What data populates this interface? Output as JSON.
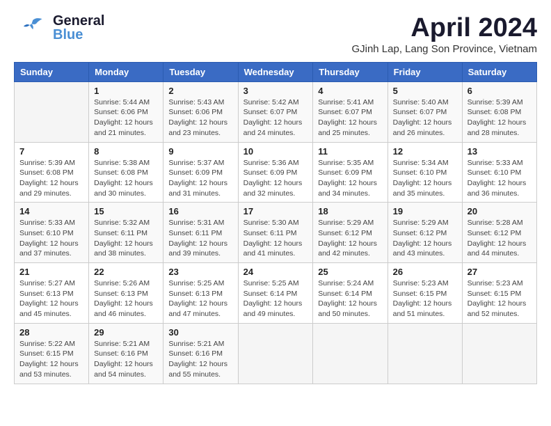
{
  "header": {
    "logo_general": "General",
    "logo_blue": "Blue",
    "month_title": "April 2024",
    "location": "GJinh Lap, Lang Son Province, Vietnam"
  },
  "weekdays": [
    "Sunday",
    "Monday",
    "Tuesday",
    "Wednesday",
    "Thursday",
    "Friday",
    "Saturday"
  ],
  "weeks": [
    [
      {
        "day": "",
        "info": ""
      },
      {
        "day": "1",
        "info": "Sunrise: 5:44 AM\nSunset: 6:06 PM\nDaylight: 12 hours\nand 21 minutes."
      },
      {
        "day": "2",
        "info": "Sunrise: 5:43 AM\nSunset: 6:06 PM\nDaylight: 12 hours\nand 23 minutes."
      },
      {
        "day": "3",
        "info": "Sunrise: 5:42 AM\nSunset: 6:07 PM\nDaylight: 12 hours\nand 24 minutes."
      },
      {
        "day": "4",
        "info": "Sunrise: 5:41 AM\nSunset: 6:07 PM\nDaylight: 12 hours\nand 25 minutes."
      },
      {
        "day": "5",
        "info": "Sunrise: 5:40 AM\nSunset: 6:07 PM\nDaylight: 12 hours\nand 26 minutes."
      },
      {
        "day": "6",
        "info": "Sunrise: 5:39 AM\nSunset: 6:08 PM\nDaylight: 12 hours\nand 28 minutes."
      }
    ],
    [
      {
        "day": "7",
        "info": "Sunrise: 5:39 AM\nSunset: 6:08 PM\nDaylight: 12 hours\nand 29 minutes."
      },
      {
        "day": "8",
        "info": "Sunrise: 5:38 AM\nSunset: 6:08 PM\nDaylight: 12 hours\nand 30 minutes."
      },
      {
        "day": "9",
        "info": "Sunrise: 5:37 AM\nSunset: 6:09 PM\nDaylight: 12 hours\nand 31 minutes."
      },
      {
        "day": "10",
        "info": "Sunrise: 5:36 AM\nSunset: 6:09 PM\nDaylight: 12 hours\nand 32 minutes."
      },
      {
        "day": "11",
        "info": "Sunrise: 5:35 AM\nSunset: 6:09 PM\nDaylight: 12 hours\nand 34 minutes."
      },
      {
        "day": "12",
        "info": "Sunrise: 5:34 AM\nSunset: 6:10 PM\nDaylight: 12 hours\nand 35 minutes."
      },
      {
        "day": "13",
        "info": "Sunrise: 5:33 AM\nSunset: 6:10 PM\nDaylight: 12 hours\nand 36 minutes."
      }
    ],
    [
      {
        "day": "14",
        "info": "Sunrise: 5:33 AM\nSunset: 6:10 PM\nDaylight: 12 hours\nand 37 minutes."
      },
      {
        "day": "15",
        "info": "Sunrise: 5:32 AM\nSunset: 6:11 PM\nDaylight: 12 hours\nand 38 minutes."
      },
      {
        "day": "16",
        "info": "Sunrise: 5:31 AM\nSunset: 6:11 PM\nDaylight: 12 hours\nand 39 minutes."
      },
      {
        "day": "17",
        "info": "Sunrise: 5:30 AM\nSunset: 6:11 PM\nDaylight: 12 hours\nand 41 minutes."
      },
      {
        "day": "18",
        "info": "Sunrise: 5:29 AM\nSunset: 6:12 PM\nDaylight: 12 hours\nand 42 minutes."
      },
      {
        "day": "19",
        "info": "Sunrise: 5:29 AM\nSunset: 6:12 PM\nDaylight: 12 hours\nand 43 minutes."
      },
      {
        "day": "20",
        "info": "Sunrise: 5:28 AM\nSunset: 6:12 PM\nDaylight: 12 hours\nand 44 minutes."
      }
    ],
    [
      {
        "day": "21",
        "info": "Sunrise: 5:27 AM\nSunset: 6:13 PM\nDaylight: 12 hours\nand 45 minutes."
      },
      {
        "day": "22",
        "info": "Sunrise: 5:26 AM\nSunset: 6:13 PM\nDaylight: 12 hours\nand 46 minutes."
      },
      {
        "day": "23",
        "info": "Sunrise: 5:25 AM\nSunset: 6:13 PM\nDaylight: 12 hours\nand 47 minutes."
      },
      {
        "day": "24",
        "info": "Sunrise: 5:25 AM\nSunset: 6:14 PM\nDaylight: 12 hours\nand 49 minutes."
      },
      {
        "day": "25",
        "info": "Sunrise: 5:24 AM\nSunset: 6:14 PM\nDaylight: 12 hours\nand 50 minutes."
      },
      {
        "day": "26",
        "info": "Sunrise: 5:23 AM\nSunset: 6:15 PM\nDaylight: 12 hours\nand 51 minutes."
      },
      {
        "day": "27",
        "info": "Sunrise: 5:23 AM\nSunset: 6:15 PM\nDaylight: 12 hours\nand 52 minutes."
      }
    ],
    [
      {
        "day": "28",
        "info": "Sunrise: 5:22 AM\nSunset: 6:15 PM\nDaylight: 12 hours\nand 53 minutes."
      },
      {
        "day": "29",
        "info": "Sunrise: 5:21 AM\nSunset: 6:16 PM\nDaylight: 12 hours\nand 54 minutes."
      },
      {
        "day": "30",
        "info": "Sunrise: 5:21 AM\nSunset: 6:16 PM\nDaylight: 12 hours\nand 55 minutes."
      },
      {
        "day": "",
        "info": ""
      },
      {
        "day": "",
        "info": ""
      },
      {
        "day": "",
        "info": ""
      },
      {
        "day": "",
        "info": ""
      }
    ]
  ]
}
